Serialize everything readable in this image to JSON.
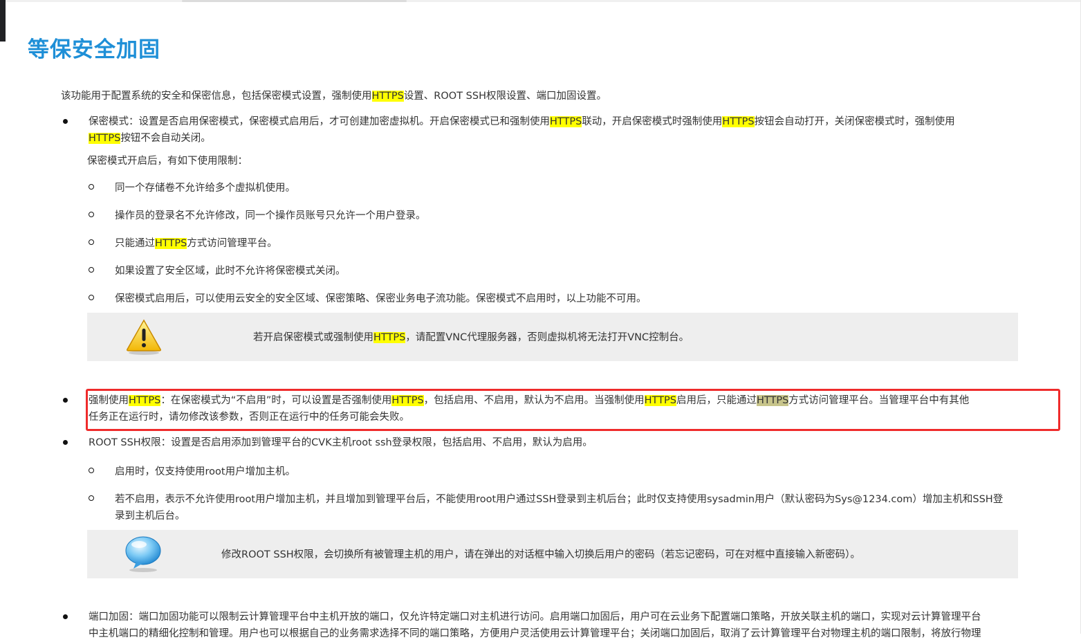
{
  "page": {
    "title": "等保安全加固",
    "intro": [
      "该功能用于配置系统的安全和保密信息，包括保密模式设置，强制使用",
      "HTTPS",
      "设置、ROOT SSH权限设置、端口加固设置。"
    ]
  },
  "secret_mode": {
    "line1": [
      "保密模式：设置是否启用保密模式，保密模式启用后，才可创建加密虚拟机。开启保密模式已和强制使用",
      "HTTPS",
      "联动，开启保密模式时强制使用",
      "HTTPS",
      "按钮会自动打开，关闭保密模式时，强制使用"
    ],
    "line2": [
      "HTTPS",
      "按钮不会自动关闭。"
    ],
    "sub_intro": "保密模式开启后，有如下使用限制：",
    "items": [
      "同一个存储卷不允许给多个虚拟机使用。",
      "操作员的登录名不允许修改，同一个操作员账号只允许一个用户登录。",
      [
        "只能通过",
        "HTTPS",
        "方式访问管理平台。"
      ],
      "如果设置了安全区域，此时不允许将保密模式关闭。",
      "保密模式启用后，可以使用云安全的安全区域、保密策略、保密业务电子流功能。保密模式不启用时，以上功能不可用。"
    ],
    "note": [
      "若开启保密模式或强制使用",
      "HTTPS",
      "，请配置VNC代理服务器，否则虚拟机将无法打开VNC控制台。"
    ],
    "note_icon": "warning-icon"
  },
  "https": {
    "line1": [
      "强制使用",
      "HTTPS",
      "：在保密模式为“不启用”时，可以设置是否强制使用",
      "HTTPS",
      "，包括启用、不启用，默认为不启用。当强制使用",
      "HTTPS",
      "启用后，只能通过",
      "HTTPS",
      "方式访问管理平台。当管理平台中有其他"
    ],
    "line2": "任务正在运行时，请勿修改该参数，否则正在运行中的任务可能会失败。",
    "highlight_color": "#ef2b2b"
  },
  "root_ssh": {
    "line": "ROOT SSH权限：设置是否启用添加到管理平台的CVK主机root ssh登录权限，包括启用、不启用，默认为启用。",
    "items": [
      "启用时，仅支持使用root用户增加主机。",
      "若不启用，表示不允许使用root用户增加主机，并且增加到管理平台后，不能使用root用户通过SSH登录到主机后台；此时仅支持使用sysadmin用户（默认密码为Sys@1234.com）增加主机和SSH登"
    ],
    "item2_line2": "录到主机后台。",
    "note": "修改ROOT SSH权限，会切换所有被管理主机的用户，请在弹出的对话框中输入切换后用户的密码（若忘记密码，可在对框中直接输入新密码）。",
    "note_icon": "speech-bubble-icon"
  },
  "port": {
    "line1": "端口加固：端口加固功能可以限制云计算管理平台中主机开放的端口，仅允许特定端口对主机进行访问。启用端口加固后，用户可在云业务下配置端口策略，开放关联主机的端口，实现对云计算管理平台",
    "line2": "中主机端口的精细化控制和管理。用户也可以根据自己的业务需求选择不同的端口策略，方便用户灵活使用云计算管理平台；关闭端口加固后，取消了云计算管理平台对物理主机的端口限制，将放行物理"
  }
}
